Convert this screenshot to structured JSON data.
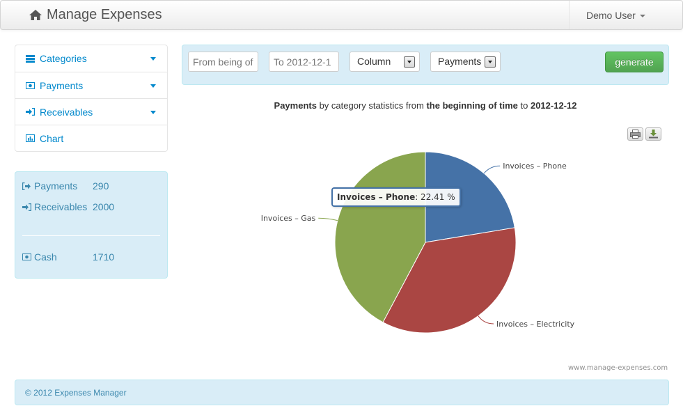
{
  "app": {
    "title": "Manage Expenses",
    "user": "Demo User"
  },
  "sidebar": {
    "items": [
      {
        "label": "Categories",
        "icon": "list-icon",
        "dropdown": true
      },
      {
        "label": "Payments",
        "icon": "money-icon",
        "dropdown": true
      },
      {
        "label": "Receivables",
        "icon": "sign-in-icon",
        "dropdown": true
      },
      {
        "label": "Chart",
        "icon": "bar-chart-icon",
        "dropdown": false
      }
    ]
  },
  "summary": {
    "payments_label": "Payments",
    "payments_value": "290",
    "receivables_label": "Receivables",
    "receivables_value": "2000",
    "cash_label": "Cash",
    "cash_value": "1710"
  },
  "toolbar": {
    "from_placeholder": "From being of",
    "to_value": "To 2012-12-1",
    "chart_type": "Column",
    "data_type": "Payments",
    "generate_label": "generate"
  },
  "chart": {
    "title_part1": "Payments",
    "title_part2": " by category statistics from ",
    "title_part3": "the beginning of time",
    "title_part4": " to ",
    "title_part5": "2012-12-12",
    "credit": "www.manage-expenses.com",
    "tooltip_name": "Invoices – Phone",
    "tooltip_value": ": 22.41 %"
  },
  "chart_data": {
    "type": "pie",
    "series": [
      {
        "name": "Invoices – Phone",
        "value": 22.41,
        "color": "#4572a7"
      },
      {
        "name": "Invoices – Electricity",
        "value": 35.36,
        "color": "#aa4643"
      },
      {
        "name": "Invoices – Gas",
        "value": 42.23,
        "color": "#89a54e"
      }
    ]
  },
  "footer": {
    "text": "© 2012 Expenses Manager"
  },
  "colors": {
    "link": "#0088cc",
    "info_bg": "#d9edf7",
    "info_text": "#3a87ad",
    "success": "#51a351"
  }
}
